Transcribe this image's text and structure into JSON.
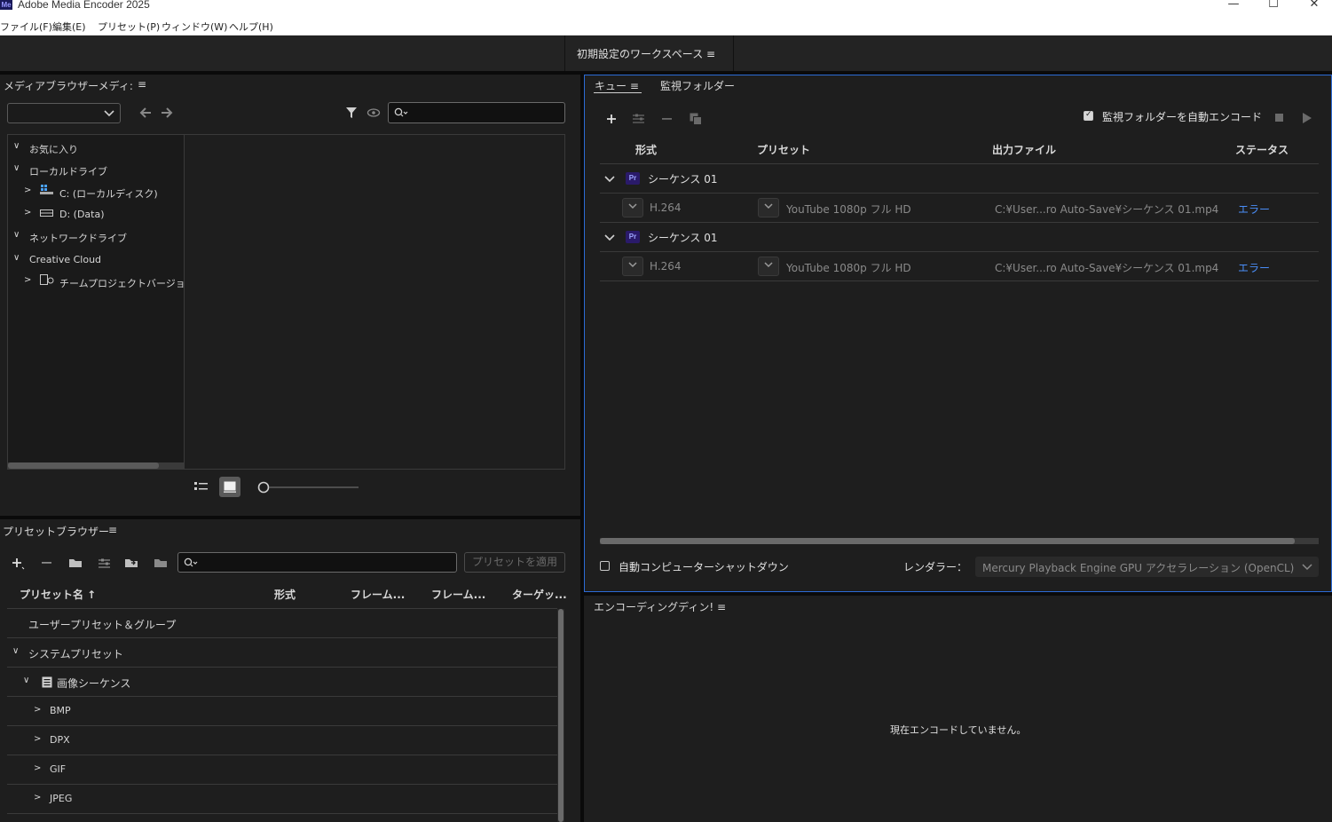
{
  "window": {
    "app_icon": "Me",
    "title": "Adobe Media Encoder 2025",
    "minimize": "—",
    "maximize": "☐",
    "close": "✕"
  },
  "menu": [
    "ファイル(F)",
    "編集(E)",
    "プリセット(P)",
    "ウィンドウ(W)",
    "ヘルプ(H)"
  ],
  "workspace": {
    "label": "初期設定のワークスペース",
    "menu_icon": "≡"
  },
  "media_browser": {
    "title": "メディアブラウザーメディ:",
    "menu_icon": "≡",
    "dropdown_value": "",
    "search_placeholder": "",
    "tree": [
      {
        "label": "お気に入り",
        "chev": "∨"
      },
      {
        "label": "ローカルドライブ",
        "chev": "∨"
      },
      {
        "label": "C: (ローカルディスク)",
        "chev": ">"
      },
      {
        "label": "D: (Data)",
        "chev": ">"
      },
      {
        "label": "ネットワークドライブ",
        "chev": "∨"
      },
      {
        "label": "Creative Cloud",
        "chev": "∨"
      },
      {
        "label": "チームプロジェクトバージョ",
        "chev": ">"
      }
    ]
  },
  "preset_browser": {
    "title": "プリセットブラウザー",
    "menu_icon": "≡",
    "apply_button": "プリセットを適用",
    "columns": [
      "プリセット名 ↑",
      "形式",
      "フレーム...",
      "フレーム...",
      "ターゲッ..."
    ],
    "rows": [
      {
        "label": "ユーザープリセット＆グループ",
        "chev": ""
      },
      {
        "label": "システムプリセット",
        "chev": "∨"
      },
      {
        "label": "画像シーケンス",
        "chev": "∨"
      },
      {
        "label": "BMP",
        "chev": ">"
      },
      {
        "label": "DPX",
        "chev": ">"
      },
      {
        "label": "GIF",
        "chev": ">"
      },
      {
        "label": "JPEG",
        "chev": ">"
      }
    ]
  },
  "queue": {
    "tab_queue": "キュー",
    "tab_menu_icon": "≡",
    "tab_watch": "監視フォルダー",
    "auto_encode_label": "監視フォルダーを自動エンコード",
    "auto_encode_checked": true,
    "columns": [
      "形式",
      "プリセット",
      "出力ファイル",
      "ステータス"
    ],
    "jobs": [
      {
        "badge": "Pr",
        "name": "シーケンス 01",
        "format": "H.264",
        "preset": "YouTube 1080p フル HD",
        "output": "C:¥User...ro Auto-Save¥シーケンス 01.mp4",
        "status": "エラー"
      },
      {
        "badge": "Pr",
        "name": "シーケンス 01",
        "format": "H.264",
        "preset": "YouTube 1080p フル HD",
        "output": "C:¥User...ro Auto-Save¥シーケンス 01.mp4",
        "status": "エラー"
      }
    ],
    "shutdown_label": "自動コンピューターシャットダウン",
    "renderer_label": "レンダラー：",
    "renderer_value": "Mercury Playback Engine GPU アクセラレーション (OpenCL)"
  },
  "encoding": {
    "title": "エンコーディングディン!",
    "menu_icon": "≡",
    "status": "現在エンコードしていません。"
  },
  "colors": {
    "accent": "#2c6bd6",
    "error": "#4a8df7",
    "bg": "#1e1e1e"
  }
}
